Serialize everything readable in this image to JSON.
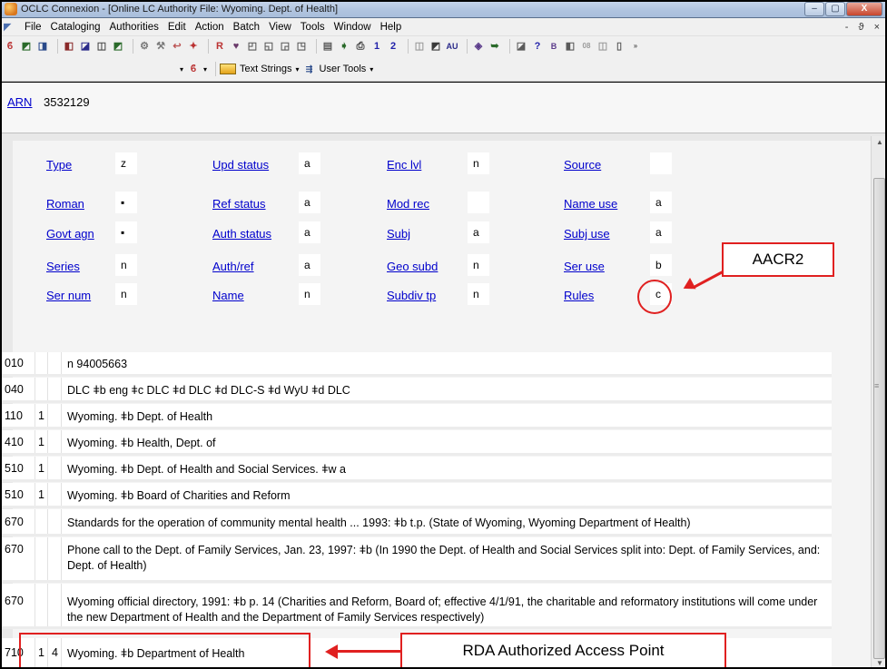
{
  "window": {
    "title": "OCLC Connexion - [Online LC Authority File: Wyoming. Dept. of Health]",
    "min_glyph": "–",
    "max_glyph": "▢",
    "close_glyph": "X"
  },
  "menu": {
    "items": [
      "File",
      "Cataloging",
      "Authorities",
      "Edit",
      "Action",
      "Batch",
      "View",
      "Tools",
      "Window",
      "Help"
    ],
    "mdi_controls": "- ϑ ×"
  },
  "toolbar2": {
    "text_strings_label": "Text Strings",
    "user_tools_label": "User Tools"
  },
  "record": {
    "arn_label": "ARN",
    "arn_value": "3532129"
  },
  "fixed_fields": [
    {
      "label": "Type",
      "value": "z"
    },
    {
      "label": "Upd status",
      "value": "a"
    },
    {
      "label": "Enc lvl",
      "value": "n"
    },
    {
      "label": "Source",
      "value": ""
    },
    {
      "label": "Roman",
      "value": "▪"
    },
    {
      "label": "Ref status",
      "value": "a"
    },
    {
      "label": "Mod rec",
      "value": ""
    },
    {
      "label": "Name use",
      "value": "a"
    },
    {
      "label": "Govt agn",
      "value": "▪"
    },
    {
      "label": "Auth status",
      "value": "a"
    },
    {
      "label": "Subj",
      "value": "a"
    },
    {
      "label": "Subj use",
      "value": "a"
    },
    {
      "label": "Series",
      "value": "n"
    },
    {
      "label": "Auth/ref",
      "value": "a"
    },
    {
      "label": "Geo subd",
      "value": "n"
    },
    {
      "label": "Ser use",
      "value": "b"
    },
    {
      "label": "Ser num",
      "value": "n"
    },
    {
      "label": "Name",
      "value": "n"
    },
    {
      "label": "Subdiv tp",
      "value": "n"
    },
    {
      "label": "Rules",
      "value": "c"
    }
  ],
  "variable_fields": [
    {
      "tag": "010",
      "ind1": "",
      "ind2": "",
      "content": "n 94005663"
    },
    {
      "tag": "040",
      "ind1": "",
      "ind2": "",
      "content": "DLC ǂb eng ǂc DLC ǂd DLC ǂd DLC-S ǂd WyU ǂd DLC"
    },
    {
      "tag": "110",
      "ind1": "1",
      "ind2": "",
      "content": "Wyoming. ǂb Dept. of Health"
    },
    {
      "tag": "410",
      "ind1": "1",
      "ind2": "",
      "content": "Wyoming. ǂb Health, Dept. of"
    },
    {
      "tag": "510",
      "ind1": "1",
      "ind2": "",
      "content": "Wyoming. ǂb Dept. of Health and Social Services. ǂw a"
    },
    {
      "tag": "510",
      "ind1": "1",
      "ind2": "",
      "content": "Wyoming. ǂb Board of Charities and Reform"
    },
    {
      "tag": "670",
      "ind1": "",
      "ind2": "",
      "content": "Standards for the operation of community mental health ... 1993: ǂb t.p. (State of Wyoming, Wyoming Department of Health)"
    },
    {
      "tag": "670",
      "ind1": "",
      "ind2": "",
      "content": "Phone call to the Dept. of Family Services, Jan. 23, 1997: ǂb (In 1990 the Dept. of Health and Social Services split into: Dept. of Family Services, and: Dept. of Health)"
    },
    {
      "tag": "670",
      "ind1": "",
      "ind2": "",
      "content": "Wyoming official directory, 1991: ǂb p. 14 (Charities and Reform, Board of; effective 4/1/91, the charitable and reformatory institutions will come under the new Department of Health and the Department of Family Services respectively)"
    },
    {
      "tag": "710",
      "ind1": "1",
      "ind2": "4",
      "content": "Wyoming. ǂb Department of Health"
    }
  ],
  "annotations": {
    "aacr2_label": "AACR2",
    "rda_label": "RDA Authorized Access Point",
    "color": "#e02020"
  }
}
